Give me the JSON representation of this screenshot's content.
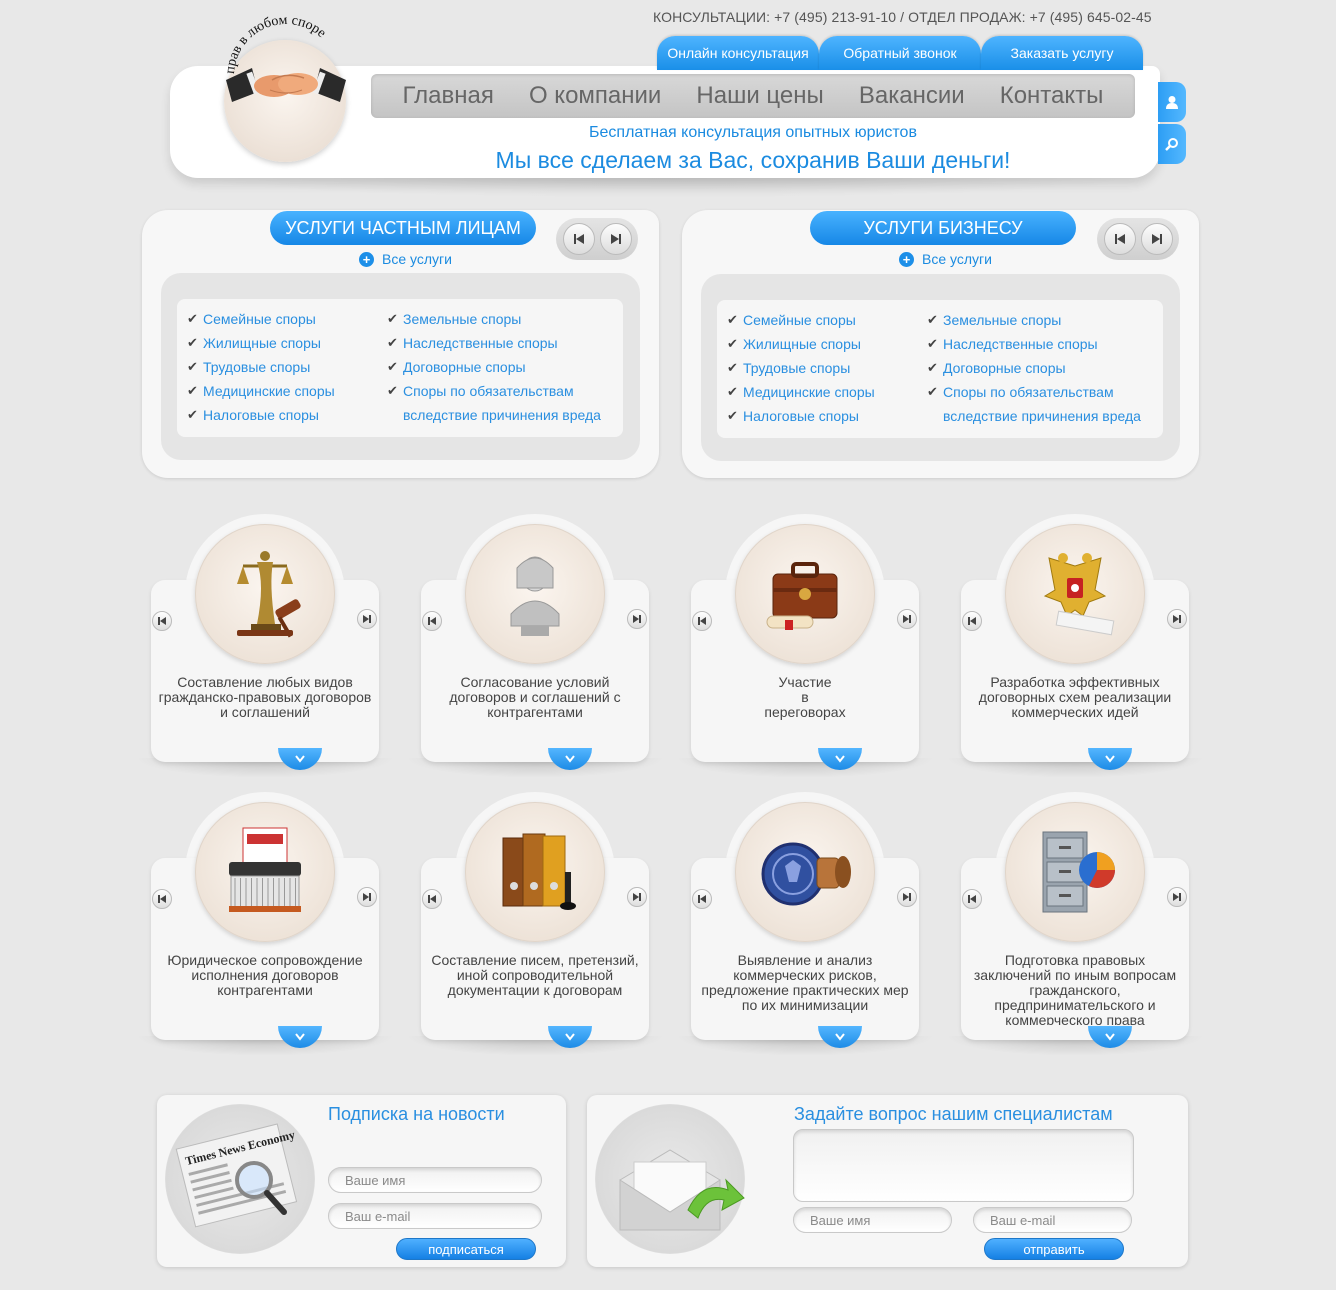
{
  "header": {
    "contacts": "КОНСУЛЬТАЦИИ: +7 (495) 213-91-10 / ОТДЕЛ ПРОДАЖ: +7 (495) 645-02-45",
    "logo_text": "прав в любом споре",
    "top_tabs": [
      "Онлайн консультация",
      "Обратный звонок",
      "Заказать услугу"
    ],
    "nav": [
      "Главная",
      "О компании",
      "Наши цены",
      "Вакансии",
      "Контакты"
    ],
    "tagline_small": "Бесплатная консультация опытных юристов",
    "tagline_big": "Мы все сделаем за Вас, сохранив Ваши деньги!",
    "side_icons": [
      "user-icon",
      "search-icon"
    ]
  },
  "panels": [
    {
      "title": "УСЛУГИ ЧАСТНЫМ ЛИЦАМ",
      "all_link": "Все услуги",
      "col1": [
        "Семейные споры",
        "Жилищные споры",
        "Трудовые споры",
        "Медицинские споры",
        "Налоговые споры"
      ],
      "col2": [
        "Земельные споры",
        "Наследственные споры",
        "Договорные споры",
        "Споры по обязательствам"
      ],
      "col2_cont": "вследствие причинения вреда"
    },
    {
      "title": "УСЛУГИ БИЗНЕСУ",
      "all_link": "Все услуги",
      "col1": [
        "Семейные споры",
        "Жилищные споры",
        "Трудовые споры",
        "Медицинские споры",
        "Налоговые споры"
      ],
      "col2": [
        "Земельные споры",
        "Наследственные споры",
        "Договорные споры",
        "Споры по обязательствам"
      ],
      "col2_cont": "вследствие причинения вреда"
    }
  ],
  "cards": [
    {
      "icon": "themis-gavel-icon",
      "text": "Составление любых видов гражданско-правовых договоров и соглашений"
    },
    {
      "icon": "judge-bust-icon",
      "text": "Согласование условий договоров и соглашений с контрагентами"
    },
    {
      "icon": "briefcase-icon",
      "text": "Участие\nв\nпереговорах"
    },
    {
      "icon": "coat-of-arms-icon",
      "text": "Разработка эффективных договорных схем реализации коммерческих идей"
    },
    {
      "icon": "certificate-shredder-icon",
      "text": "Юридическое сопровождение исполнения договоров контрагентами"
    },
    {
      "icon": "binders-icon",
      "text": "Составление писем, претензий, иной сопроводительной документации к договорам"
    },
    {
      "icon": "stamp-icon",
      "text": "Выявление и анализ коммерческих рисков, предложение практических мер по их минимизации"
    },
    {
      "icon": "file-cabinet-chart-icon",
      "text": "Подготовка правовых заключений по иным вопросам гражданского, предпринимательского и коммерческого права"
    }
  ],
  "subscribe": {
    "title": "Подписка на новости",
    "newspaper_label": "Times News Economy",
    "name_placeholder": "Ваше имя",
    "email_placeholder": "Ваш e-mail",
    "button": "подписаться"
  },
  "ask": {
    "title": "Задайте вопрос нашим специалистам",
    "name_placeholder": "Ваше имя",
    "email_placeholder": "Ваш e-mail",
    "button": "отправить"
  },
  "colors": {
    "accent": "#1b8be0",
    "tab_blue": "#2a9cf2",
    "background": "#e8e8e8"
  }
}
